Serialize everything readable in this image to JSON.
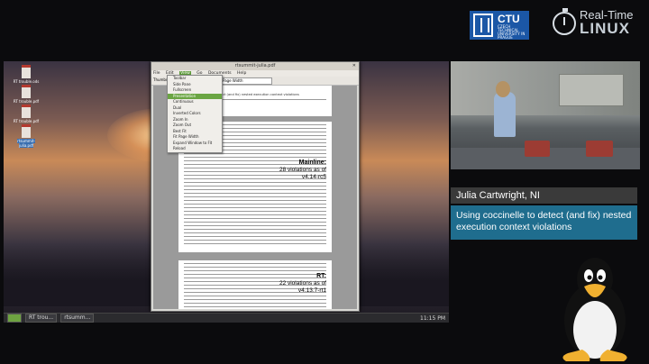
{
  "branding": {
    "ctu_label": "CTU",
    "ctu_subtitle": "CZECH TECHNICAL UNIVERSITY IN PRAGUE",
    "rt_line1": "Real-Time",
    "rt_line2": "LINUX"
  },
  "desktop": {
    "icons": [
      {
        "label": "RT trouble.ods"
      },
      {
        "label": "RT trouble.pdf"
      },
      {
        "label": "RT trouble.pdf"
      },
      {
        "label": "rtsummit-julia.pdf"
      }
    ],
    "taskbar": {
      "items": [
        "RT trou...",
        "rtsumm..."
      ],
      "clock": "11:15 PM"
    }
  },
  "pdf_window": {
    "title": "rtsummit-julia.pdf",
    "menu": [
      "File",
      "Edit",
      "View",
      "Go",
      "Documents",
      "Help"
    ],
    "zoom": "Fit Page Width",
    "side_label": "Thumbnails",
    "view_menu": [
      "Toolbar",
      "Side Pane",
      "Fullscreen",
      "Presentation",
      "Continuous",
      "Dual",
      "Inverted Colors",
      "Zoom In",
      "Zoom Out",
      "Best Fit",
      "Fit Page Width",
      "Expand Window to Fit",
      "Reload"
    ],
    "active_menu": "View",
    "highlighted_item": "Presentation",
    "page_header": "Using coccinelle to detect (and fix) nested execution context violations",
    "note_mainline_title": "Mainline:",
    "note_mainline_count": "28 violations as of",
    "note_mainline_version": "v4.14-rc5",
    "note_rt_title": "RT:",
    "note_rt_count": "22 violations as of",
    "note_rt_version": "v4.13.7-rt1"
  },
  "speaker": {
    "name": "Julia Cartwright, NI",
    "talk_title": "Using coccinelle to detect (and fix) nested execution context violations"
  },
  "colors": {
    "caption_blue": "#1f6d8e",
    "caption_gray": "#3a3a3a",
    "ctu_blue": "#1b57a6",
    "menu_green": "#6aa543"
  }
}
